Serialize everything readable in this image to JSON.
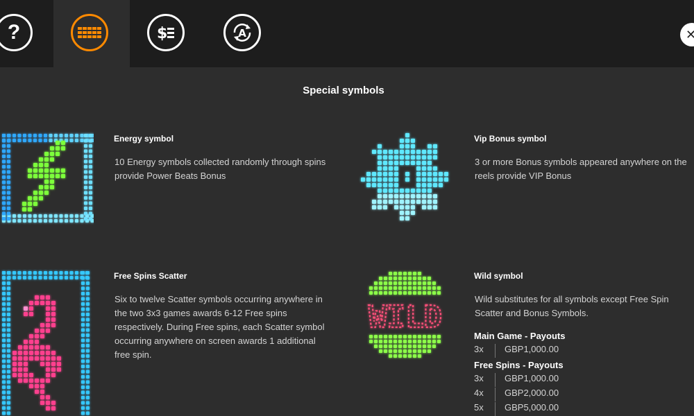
{
  "tabs": [
    {
      "name": "help",
      "icon": "question-icon",
      "glyph": "?"
    },
    {
      "name": "symbols",
      "icon": "grid-icon",
      "active": true
    },
    {
      "name": "paytable",
      "icon": "dollar-list-icon",
      "glyph": "$"
    },
    {
      "name": "autoplay",
      "icon": "auto-rotate-icon",
      "glyph": "A"
    }
  ],
  "close_glyph": "✕",
  "title": "Special symbols",
  "symbols": {
    "energy": {
      "heading": "Energy symbol",
      "description": "10 Energy symbols collected randomly through spins provide Power Beats Bonus"
    },
    "vip": {
      "heading": "Vip Bonus symbol",
      "description": "3 or more Bonus symbols appeared anywhere on the reels provide VIP Bonus"
    },
    "scatter": {
      "heading": "Free Spins Scatter",
      "description": "Six to twelve Scatter symbols occurring anywhere in the two 3x3 games awards 6-12 Free spins respectively. During Free spins, each Scatter symbol occurring anywhere on screen awards 1 additional free spin."
    },
    "wild": {
      "heading": "Wild symbol",
      "description": "Wild substitutes for all symbols except Free Spin Scatter and Bonus Symbols.",
      "logo_text": "WILD"
    }
  },
  "payouts": {
    "main_title": "Main Game - Payouts",
    "main": [
      {
        "count": "3x",
        "amount": "GBP1,000.00"
      }
    ],
    "free_title": "Free Spins - Payouts",
    "free": [
      {
        "count": "3x",
        "amount": "GBP1,000.00"
      },
      {
        "count": "4x",
        "amount": "GBP2,000.00"
      },
      {
        "count": "5x",
        "amount": "GBP5,000.00"
      }
    ]
  },
  "colors": {
    "accent": "#ff8a00",
    "energy_frame": "#2fa8ff",
    "energy_bolt": "#7dff3a",
    "vip": "#5ee8ff",
    "scatter_frame": "#36c8ff",
    "scatter_glyph": "#ff3f8e",
    "wild_green": "#8cff4a",
    "wild_text": "#ff4f7a"
  }
}
